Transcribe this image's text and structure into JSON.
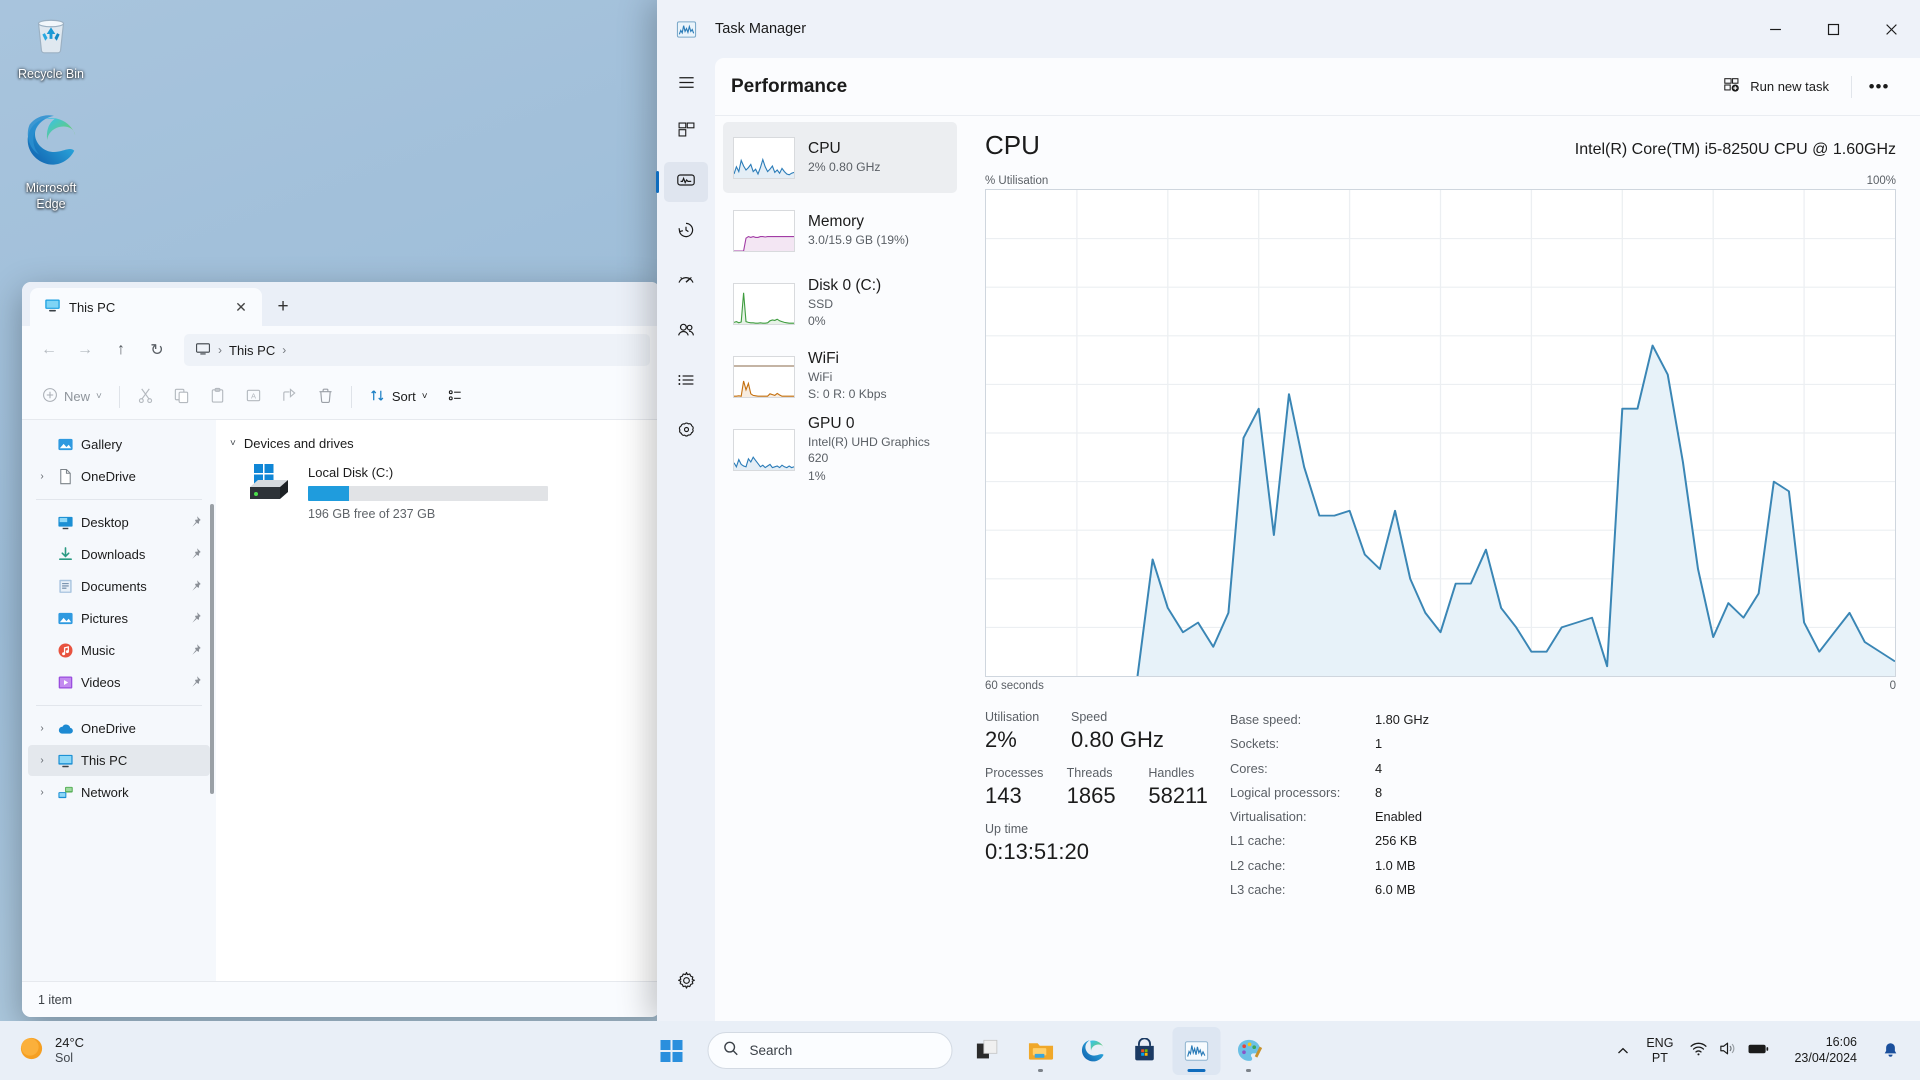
{
  "desktop": {
    "icons": [
      {
        "label": "Recycle Bin",
        "icon": "recycle-bin-icon"
      },
      {
        "label": "Microsoft\nEdge",
        "label_line1": "Microsoft",
        "label_line2": "Edge",
        "icon": "microsoft-edge-icon"
      }
    ]
  },
  "explorer": {
    "tab": {
      "title": "This PC",
      "close": "✕",
      "new_tab": "+"
    },
    "nav_buttons": {
      "back": "←",
      "forward": "→",
      "up": "↑",
      "refresh": "↻"
    },
    "breadcrumb": {
      "root_icon": "this-pc-icon",
      "sep": "›",
      "current": "This PC",
      "trailing_sep": "›"
    },
    "toolbar": {
      "new_label": "New",
      "new_chevron": "˅",
      "cut": "cut-icon",
      "copy": "copy-icon",
      "paste": "paste-icon",
      "rename": "rename-icon",
      "share": "share-icon",
      "delete": "delete-icon",
      "sort_label": "Sort",
      "sort_chevron": "˅",
      "view_label": "view-icon"
    },
    "sidebar": {
      "items": [
        {
          "label": "Gallery",
          "icon": "gallery-icon",
          "chevron": "",
          "pinned": false,
          "selected": false
        },
        {
          "label": "OneDrive",
          "icon": "onedrive-file-icon",
          "chevron": "›",
          "pinned": false,
          "selected": false
        },
        {
          "divider": true
        },
        {
          "label": "Desktop",
          "icon": "desktop-icon",
          "chevron": "",
          "pinned": true,
          "selected": false
        },
        {
          "label": "Downloads",
          "icon": "downloads-icon",
          "chevron": "",
          "pinned": true,
          "selected": false
        },
        {
          "label": "Documents",
          "icon": "documents-icon",
          "chevron": "",
          "pinned": true,
          "selected": false
        },
        {
          "label": "Pictures",
          "icon": "pictures-icon",
          "chevron": "",
          "pinned": true,
          "selected": false
        },
        {
          "label": "Music",
          "icon": "music-icon",
          "chevron": "",
          "pinned": true,
          "selected": false
        },
        {
          "label": "Videos",
          "icon": "videos-icon",
          "chevron": "",
          "pinned": true,
          "selected": false
        },
        {
          "divider": true
        },
        {
          "label": "OneDrive",
          "icon": "onedrive-cloud-icon",
          "chevron": "›",
          "pinned": false,
          "selected": false
        },
        {
          "label": "This PC",
          "icon": "this-pc-icon",
          "chevron": "›",
          "pinned": false,
          "selected": true
        },
        {
          "label": "Network",
          "icon": "network-icon",
          "chevron": "›",
          "pinned": false,
          "selected": false
        }
      ]
    },
    "content": {
      "group_title": "Devices and drives",
      "group_chevron": "˅",
      "drive": {
        "name": "Local Disk (C:)",
        "free_text": "196 GB free of 237 GB",
        "used_percent": 17,
        "bar_color": "#1f9cdd"
      }
    },
    "status": {
      "item_count": "1 item"
    }
  },
  "taskmanager": {
    "title": "Task Manager",
    "app_icon": "task-manager-icon",
    "window_controls": {
      "minimize": "─",
      "maximize": "☐",
      "close": "✕"
    },
    "rail": [
      {
        "name": "hamburger-menu-icon",
        "active": false
      },
      {
        "name": "processes-icon",
        "active": false
      },
      {
        "name": "performance-icon",
        "active": true
      },
      {
        "name": "app-history-icon",
        "active": false
      },
      {
        "name": "startup-apps-icon",
        "active": false
      },
      {
        "name": "users-icon",
        "active": false
      },
      {
        "name": "details-icon",
        "active": false
      },
      {
        "name": "services-icon",
        "active": false
      }
    ],
    "rail_settings": {
      "name": "settings-gear-icon"
    },
    "header": {
      "page_title": "Performance",
      "run_new_task": "Run new task",
      "run_new_task_icon": "run-new-task-icon",
      "more_options": "•••"
    },
    "resources": [
      {
        "name": "CPU",
        "sub1": "2%  0.80 GHz",
        "sub2": "",
        "color": "#2b7cb8",
        "selected": true,
        "spark": "cpu-sparkline"
      },
      {
        "name": "Memory",
        "sub1": "3.0/15.9 GB (19%)",
        "sub2": "",
        "color": "#a23ca5",
        "selected": false,
        "spark": "memory-sparkline"
      },
      {
        "name": "Disk 0 (C:)",
        "sub1": "SSD",
        "sub2": "0%",
        "color": "#3f9c3f",
        "selected": false,
        "spark": "disk-sparkline"
      },
      {
        "name": "WiFi",
        "sub1": "WiFi",
        "sub2": "S: 0 R: 0 Kbps",
        "color": "#c4700f",
        "selected": false,
        "spark": "wifi-sparkline"
      },
      {
        "name": "GPU 0",
        "sub1": "Intel(R) UHD Graphics 620",
        "sub2": "1%",
        "color": "#2b7cb8",
        "selected": false,
        "spark": "gpu-sparkline"
      }
    ],
    "detail": {
      "title": "CPU",
      "model": "Intel(R) Core(TM) i5-8250U CPU @ 1.60GHz",
      "chart_axis_left": "% Utilisation",
      "chart_axis_right": "100%",
      "chart_foot_left": "60 seconds",
      "chart_foot_right": "0",
      "stats": [
        {
          "label": "Utilisation",
          "value": "2%"
        },
        {
          "label": "Speed",
          "value": "0.80 GHz"
        },
        {
          "label": "Processes",
          "value": "143"
        },
        {
          "label": "Threads",
          "value": "1865"
        },
        {
          "label": "Handles",
          "value": "58211"
        },
        {
          "label": "Up time",
          "value": "0:13:51:20"
        }
      ],
      "specs": [
        {
          "key": "Base speed:",
          "value": "1.80 GHz"
        },
        {
          "key": "Sockets:",
          "value": "1"
        },
        {
          "key": "Cores:",
          "value": "4"
        },
        {
          "key": "Logical processors:",
          "value": "8"
        },
        {
          "key": "Virtualisation:",
          "value": "Enabled"
        },
        {
          "key": "L1 cache:",
          "value": "256 KB"
        },
        {
          "key": "L2 cache:",
          "value": "1.0 MB"
        },
        {
          "key": "L3 cache:",
          "value": "6.0 MB"
        }
      ]
    }
  },
  "chart_data": {
    "type": "area",
    "title": "CPU % Utilisation",
    "xlabel": "60 seconds",
    "ylabel": "% Utilisation",
    "ylim": [
      0,
      100
    ],
    "xlim": [
      60,
      0
    ],
    "grid": true,
    "line_color": "#3a86b5",
    "fill_color": "#e7f2f9",
    "x": [
      0,
      1,
      2,
      3,
      4,
      5,
      6,
      7,
      8,
      9,
      10,
      11,
      12,
      13,
      14,
      15,
      16,
      17,
      18,
      19,
      20,
      21,
      22,
      23,
      24,
      25,
      26,
      27,
      28,
      29,
      30,
      31,
      32,
      33,
      34,
      35,
      36,
      37,
      38,
      39,
      40,
      41,
      42,
      43,
      44,
      45,
      46,
      47,
      48,
      49,
      50,
      51,
      52,
      53,
      54,
      55,
      56,
      57,
      58,
      59,
      60
    ],
    "values": [
      0,
      0,
      0,
      0,
      0,
      0,
      0,
      0,
      0,
      0,
      0,
      24,
      14,
      9,
      11,
      6,
      13,
      49,
      55,
      29,
      58,
      43,
      33,
      33,
      34,
      25,
      22,
      34,
      20,
      13,
      9,
      19,
      19,
      26,
      14,
      10,
      5,
      5,
      10,
      11,
      12,
      2,
      55,
      55,
      68,
      62,
      44,
      22,
      8,
      15,
      12,
      17,
      40,
      38,
      11,
      5,
      9,
      13,
      7,
      5,
      3
    ]
  },
  "taskbar": {
    "weather": {
      "temp": "24°C",
      "condition": "Sol",
      "icon": "sun-icon"
    },
    "start": {
      "name": "start-button-icon"
    },
    "search": {
      "placeholder": "Search",
      "icon": "search-icon"
    },
    "apps": [
      {
        "name": "task-view-icon",
        "active": false,
        "running": false
      },
      {
        "name": "file-explorer-icon",
        "active": false,
        "running": true
      },
      {
        "name": "microsoft-edge-icon",
        "active": false,
        "running": false
      },
      {
        "name": "microsoft-store-icon",
        "active": false,
        "running": false
      },
      {
        "name": "task-manager-icon",
        "active": true,
        "running": true
      },
      {
        "name": "paint-icon",
        "active": false,
        "running": true
      }
    ],
    "tray": {
      "chevron": "˄",
      "lang_line1": "ENG",
      "lang_line2": "PT",
      "wifi": "wifi-icon",
      "volume": "volume-icon",
      "battery": "battery-icon",
      "time": "16:06",
      "date": "23/04/2024",
      "notification": "notification-bell-icon"
    }
  }
}
